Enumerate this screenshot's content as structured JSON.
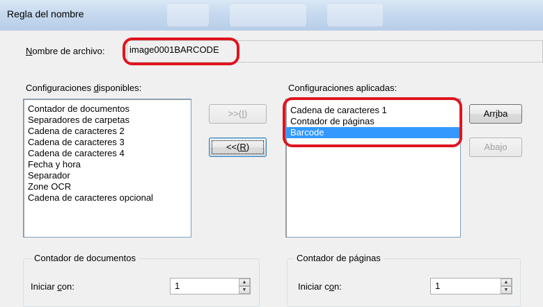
{
  "window": {
    "title": "Regla del nombre"
  },
  "filename": {
    "label_prefix": "N",
    "label_rest": "ombre de archivo:",
    "value": "image0001BARCODE"
  },
  "available": {
    "label_pre": "Configuraciones ",
    "label_ul": "d",
    "label_post": "isponibles:",
    "items": [
      "Contador de documentos",
      "Separadores de carpetas",
      "Cadena de caracteres 2",
      "Cadena de caracteres 3",
      "Cadena de caracteres 4",
      "Fecha y hora",
      "Separador",
      "Zone OCR",
      "Cadena de caracteres opcional"
    ]
  },
  "applied": {
    "label": "Configuraciones aplicadas:",
    "items": [
      "Cadena de caracteres 1",
      "Contador de páginas",
      "Barcode"
    ],
    "selected_index": 2
  },
  "buttons": {
    "add_pre": ">>(",
    "add_ul": "I",
    "add_post": ")",
    "remove_pre": "<<(",
    "remove_ul": "R",
    "remove_post": ")",
    "up_pre": "Arr",
    "up_ul": "i",
    "up_post": "ba",
    "down": "Abajo"
  },
  "doc_counter": {
    "title": "Contador de documentos",
    "start_pre": "Iniciar ",
    "start_ul": "c",
    "start_post": "on:",
    "start_value": "1"
  },
  "page_counter": {
    "title": "Contador de páginas",
    "start_pre": "Iniciar c",
    "start_ul": "o",
    "start_post": "n:",
    "start_value": "1"
  },
  "colors": {
    "highlight": "#3399ff",
    "annotation_red": "#e0141e",
    "titlebar": "#c6d9ef"
  }
}
